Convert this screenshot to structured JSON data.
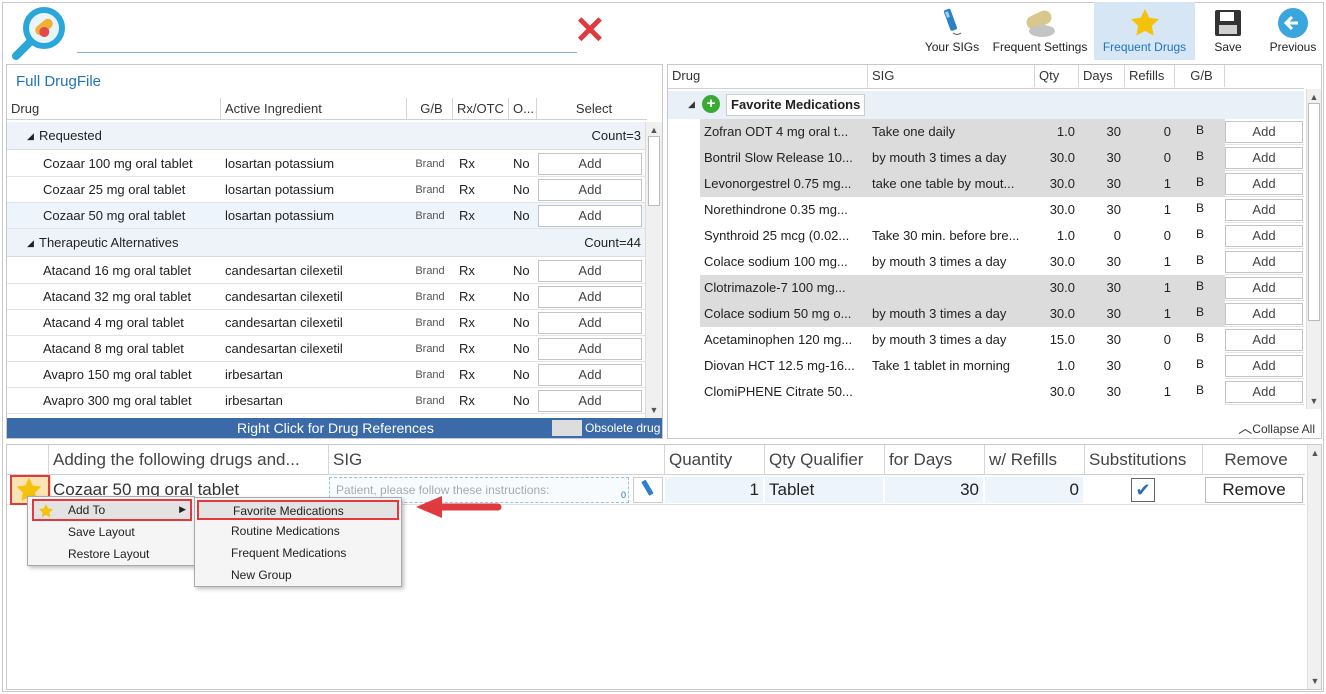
{
  "toolbar": {
    "buttons": [
      {
        "label": "Your SIGs",
        "icon": "pen-icon"
      },
      {
        "label": "Frequent Settings",
        "icon": "pills-icon"
      },
      {
        "label": "Frequent Drugs",
        "icon": "star-icon",
        "active": true
      },
      {
        "label": "Save",
        "icon": "save-icon"
      },
      {
        "label": "Previous",
        "icon": "back-arrow-icon"
      }
    ]
  },
  "left": {
    "title": "Full DrugFile",
    "columns": [
      "Drug",
      "Active Ingredient",
      "G/B",
      "Rx/OTC",
      "O...",
      "Select"
    ],
    "groups": [
      {
        "name": "Requested",
        "count": "Count=3",
        "rows": [
          {
            "drug": "Cozaar 100 mg oral tablet",
            "ing": "losartan potassium",
            "gb": "Brand",
            "rx": "Rx",
            "o": "No",
            "btn": "Add"
          },
          {
            "drug": "Cozaar 25 mg oral tablet",
            "ing": "losartan potassium",
            "gb": "Brand",
            "rx": "Rx",
            "o": "No",
            "btn": "Add"
          },
          {
            "drug": "Cozaar 50 mg oral tablet",
            "ing": "losartan potassium",
            "gb": "Brand",
            "rx": "Rx",
            "o": "No",
            "btn": "Add"
          }
        ]
      },
      {
        "name": "Therapeutic Alternatives",
        "count": "Count=44",
        "rows": [
          {
            "drug": "Atacand 16 mg oral tablet",
            "ing": "candesartan cilexetil",
            "gb": "Brand",
            "rx": "Rx",
            "o": "No",
            "btn": "Add"
          },
          {
            "drug": "Atacand 32 mg oral tablet",
            "ing": "candesartan cilexetil",
            "gb": "Brand",
            "rx": "Rx",
            "o": "No",
            "btn": "Add"
          },
          {
            "drug": "Atacand 4 mg oral tablet",
            "ing": "candesartan cilexetil",
            "gb": "Brand",
            "rx": "Rx",
            "o": "No",
            "btn": "Add"
          },
          {
            "drug": "Atacand 8 mg oral tablet",
            "ing": "candesartan cilexetil",
            "gb": "Brand",
            "rx": "Rx",
            "o": "No",
            "btn": "Add"
          },
          {
            "drug": "Avapro 150 mg oral tablet",
            "ing": "irbesartan",
            "gb": "Brand",
            "rx": "Rx",
            "o": "No",
            "btn": "Add"
          },
          {
            "drug": "Avapro 300 mg oral tablet",
            "ing": "irbesartan",
            "gb": "Brand",
            "rx": "Rx",
            "o": "No",
            "btn": "Add"
          }
        ]
      }
    ],
    "footer": "Right Click for Drug References",
    "obsolete": "Obsolete drug"
  },
  "right": {
    "columns": [
      "Drug",
      "SIG",
      "Qty",
      "Days",
      "Refills",
      "G/B"
    ],
    "group": "Favorite Medications",
    "rows": [
      {
        "drug": "Zofran ODT 4 mg oral t...",
        "sig": "Take one daily",
        "qty": "1.0",
        "days": "30",
        "refills": "0",
        "gb": "B",
        "btn": "Add",
        "hl": true
      },
      {
        "drug": "Bontril Slow Release 10...",
        "sig": "by mouth 3 times a day",
        "qty": "30.0",
        "days": "30",
        "refills": "0",
        "gb": "B",
        "btn": "Add",
        "hl": true
      },
      {
        "drug": "Levonorgestrel 0.75 mg...",
        "sig": "take one table by mout...",
        "qty": "30.0",
        "days": "30",
        "refills": "1",
        "gb": "B",
        "btn": "Add",
        "hl": true
      },
      {
        "drug": "Norethindrone 0.35 mg...",
        "sig": "",
        "qty": "30.0",
        "days": "30",
        "refills": "1",
        "gb": "B",
        "btn": "Add",
        "hl": false
      },
      {
        "drug": "Synthroid 25 mcg (0.02...",
        "sig": "Take 30 min. before bre...",
        "qty": "1.0",
        "days": "0",
        "refills": "0",
        "gb": "B",
        "btn": "Add",
        "hl": false
      },
      {
        "drug": "Colace sodium 100 mg...",
        "sig": "by mouth 3 times a day",
        "qty": "30.0",
        "days": "30",
        "refills": "1",
        "gb": "B",
        "btn": "Add",
        "hl": false
      },
      {
        "drug": "Clotrimazole-7 100 mg...",
        "sig": "",
        "qty": "30.0",
        "days": "30",
        "refills": "1",
        "gb": "B",
        "btn": "Add",
        "hl": true
      },
      {
        "drug": "Colace sodium 50 mg o...",
        "sig": "by mouth 3 times a day",
        "qty": "30.0",
        "days": "30",
        "refills": "1",
        "gb": "B",
        "btn": "Add",
        "hl": true
      },
      {
        "drug": "Acetaminophen 120 mg...",
        "sig": "by mouth 3 times a day",
        "qty": "15.0",
        "days": "30",
        "refills": "0",
        "gb": "B",
        "btn": "Add",
        "hl": false
      },
      {
        "drug": "Diovan HCT 12.5 mg-16...",
        "sig": "Take 1 tablet in morning",
        "qty": "1.0",
        "days": "30",
        "refills": "0",
        "gb": "B",
        "btn": "Add",
        "hl": false
      },
      {
        "drug": "ClomiPHENE Citrate 50...",
        "sig": "",
        "qty": "30.0",
        "days": "30",
        "refills": "1",
        "gb": "B",
        "btn": "Add",
        "hl": false
      }
    ],
    "collapse": "Collapse All"
  },
  "bottom": {
    "columns": [
      "Adding the following drugs and...",
      "SIG",
      "Quantity",
      "Qty Qualifier",
      "for Days",
      "w/ Refills",
      "Substitutions",
      "Remove"
    ],
    "row": {
      "drug": "Cozaar 50 mg oral tablet",
      "sig_placeholder": "Patient, please follow these instructions:",
      "sig_count": "0",
      "quantity": "1",
      "qualifier": "Tablet",
      "days": "30",
      "refills": "0",
      "remove": "Remove"
    }
  },
  "context_menu": {
    "items": [
      "Add To",
      "Save Layout",
      "Restore Layout"
    ],
    "submenu": [
      "Favorite Medications",
      "Routine Medications",
      "Frequent Medications",
      "New Group"
    ]
  },
  "colors": {
    "accent": "#1e73be",
    "highlight_red": "#e0393e",
    "footer_blue": "#3b6aa8",
    "row_gray": "#dcdcdc"
  }
}
